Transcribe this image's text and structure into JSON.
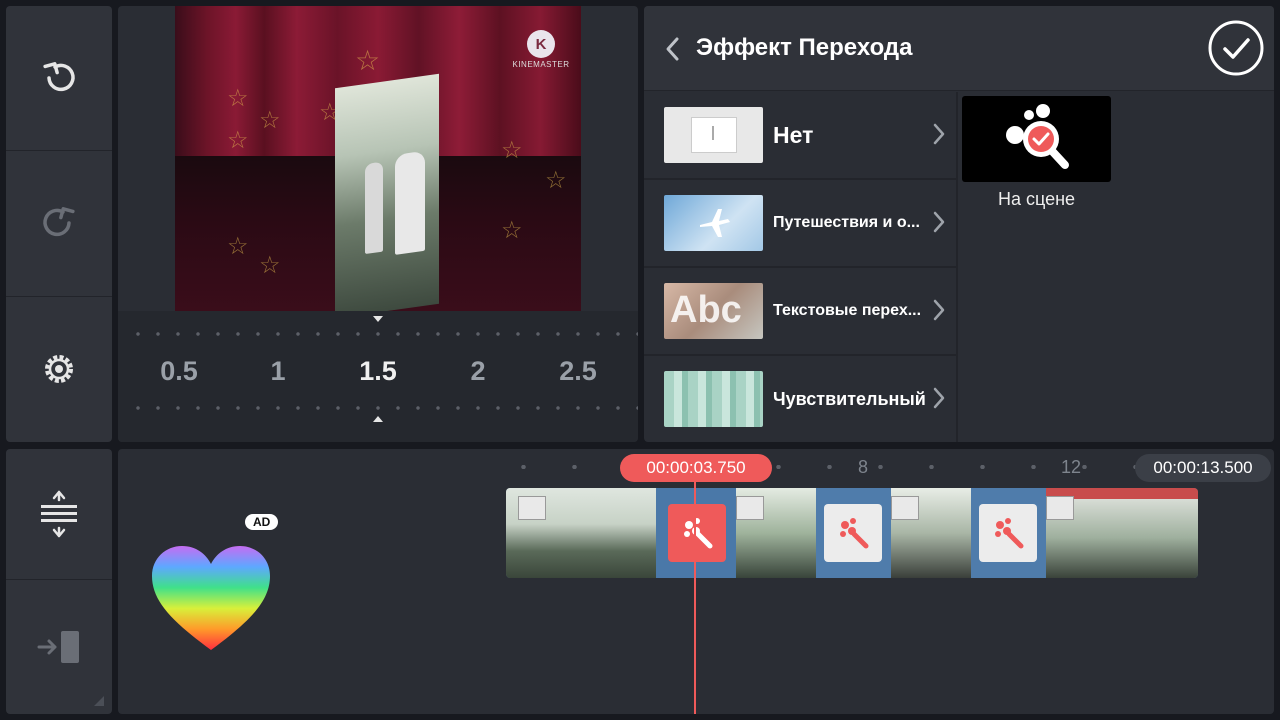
{
  "sidebar": {
    "undo_icon": "undo-icon",
    "redo_icon": "redo-icon",
    "settings_icon": "gear-icon",
    "expand_icon": "expand-vertical-icon",
    "export_icon": "export-icon"
  },
  "preview": {
    "logo_letter": "K",
    "logo_text": "KINEMASTER"
  },
  "speed_ruler": {
    "values": [
      "0.5",
      "1",
      "1.5",
      "2",
      "2.5"
    ],
    "selected": "1.5"
  },
  "header": {
    "back_icon": "chevron-left-icon",
    "title": "Эффект Перехода",
    "confirm_icon": "check-circle-icon"
  },
  "categories": [
    {
      "label": "Нет",
      "thumb": "none-thumb"
    },
    {
      "label": "Путешествия и о...",
      "thumb": "airplane-thumb"
    },
    {
      "label": "Текстовые перех...",
      "thumb": "abc-thumb"
    },
    {
      "label": "Чувствительный",
      "thumb": "sensitive-thumb"
    }
  ],
  "effect": {
    "label": "На сцене",
    "icon": "magnifier-check-icon"
  },
  "timeline": {
    "current_time": "00:00:03.750",
    "total_time": "00:00:13.500",
    "tick_labels": [
      "8",
      "12"
    ],
    "ad_badge": "AD"
  },
  "colors": {
    "accent": "#ef5a5a",
    "panel": "#2a2d34",
    "background": "#17191f"
  }
}
